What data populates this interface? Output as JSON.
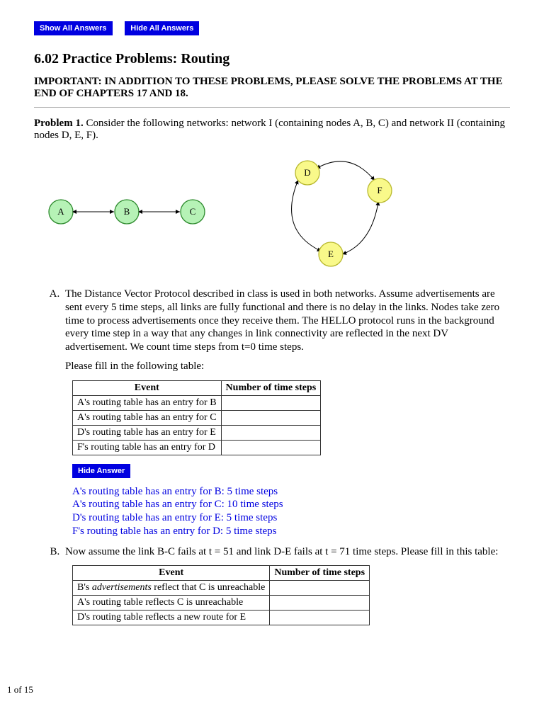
{
  "buttons": {
    "show_all": "Show All Answers",
    "hide_all": "Hide All Answers",
    "hide": "Hide Answer"
  },
  "title": "6.02 Practice Problems: Routing",
  "important": "IMPORTANT: IN ADDITION TO THESE PROBLEMS, PLEASE SOLVE THE PROBLEMS AT THE END OF CHAPTERS 17 AND 18.",
  "problem1": {
    "label": "Problem 1.",
    "text": " Consider the following networks: network I (containing nodes A, B, C) and network II (containing nodes D, E, F)."
  },
  "network1": {
    "nodes": [
      "A",
      "B",
      "C"
    ]
  },
  "network2": {
    "nodes": [
      "D",
      "F",
      "E"
    ]
  },
  "partA": {
    "text": "The Distance Vector Protocol described in class is used in both networks. Assume advertisements are sent every 5 time steps, all links are fully functional and there is no delay in the links. Nodes take zero time to process advertisements once they receive them. The HELLO protocol runs in the background every time step in a way that any changes in link connectivity are reflected in the next DV advertisement. We count time steps from t=0 time steps.",
    "prompt": "Please fill in the following table:",
    "headers": {
      "event": "Event",
      "steps": "Number of time steps"
    },
    "rows": [
      "A's routing table has an entry for B",
      "A's routing table has an entry for C",
      "D's routing table has an entry for E",
      "F's routing table has an entry for D"
    ],
    "answer": [
      "A's routing table has an entry for B: 5 time steps",
      "A's routing table has an entry for C: 10 time steps",
      "D's routing table has an entry for E: 5 time steps",
      "F's routing table has an entry for D: 5 time steps"
    ]
  },
  "partB": {
    "text": "Now assume the link B-C fails at t = 51 and link D-E fails at t = 71 time steps. Please fill in this table:",
    "headers": {
      "event": "Event",
      "steps": "Number of time steps"
    },
    "rows": [
      {
        "pre": "B's ",
        "em": "advertisements",
        "post": " reflect that C is unreachable"
      },
      {
        "pre": "A's routing table reflects C is unreachable",
        "em": "",
        "post": ""
      },
      {
        "pre": "D's routing table reflects a new route for E",
        "em": "",
        "post": ""
      }
    ]
  },
  "footer": "1 of 15"
}
